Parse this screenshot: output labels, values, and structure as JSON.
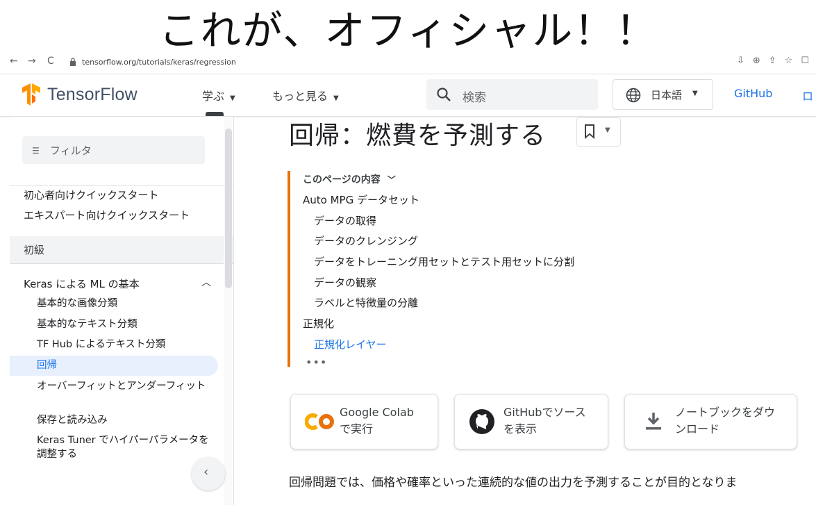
{
  "caption": "これが、オフィシャル！！",
  "browser": {
    "url": "tensorflow.org/tutorials/keras/regression",
    "back": "←",
    "forward": "→",
    "reload": "C"
  },
  "header": {
    "logo_text": "TensorFlow",
    "nav": [
      {
        "label": "学ぶ"
      },
      {
        "label": "もっと見る"
      }
    ],
    "search_placeholder": "検索",
    "language": "日本語",
    "github": "GitHub",
    "login": "ロ"
  },
  "sidebar": {
    "filter_placeholder": "フィルタ",
    "top_items": [
      "初心者向けクイックスタート",
      "エキスパート向けクイックスタート"
    ],
    "section_beginner": "初級",
    "section_keras": "Keras による ML の基本",
    "sub_items": [
      "基本的な画像分類",
      "基本的なテキスト分類",
      "TF Hub によるテキスト分類",
      "回帰",
      "オーバーフィットとアンダーフィット",
      "保存と読み込み",
      "Keras Tuner でハイパーパラメータを調整する"
    ]
  },
  "main": {
    "title": "回帰：燃費を予測する",
    "toc_heading": "このページの内容",
    "toc": [
      "Auto MPG データセット",
      "データの取得",
      "データのクレンジング",
      "データをトレーニング用セットとテスト用セットに分割",
      "データの観察",
      "ラベルと特徴量の分離",
      "正規化",
      "正規化レイヤー"
    ],
    "toc_more": "•••",
    "cards": [
      {
        "line1": "Google Colab",
        "line2": "で実行"
      },
      {
        "line1": "GitHubでソース",
        "line2": "を表示"
      },
      {
        "line1": "ノートブックをダウ",
        "line2": "ンロード"
      }
    ],
    "intro": "回帰問題では、価格や確率といった連続的な値の出力を予測することが目的となりま"
  },
  "colors": {
    "accent_orange": "#e8710a",
    "link_blue": "#1a73e8",
    "active_bg": "#e8f0fe"
  }
}
